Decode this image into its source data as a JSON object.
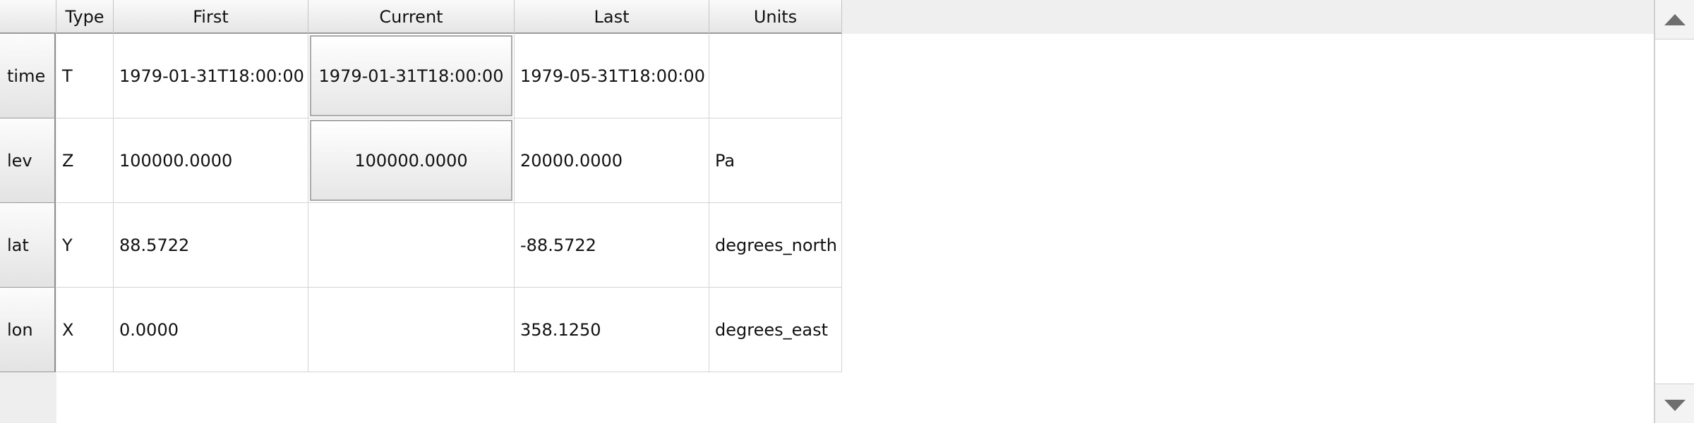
{
  "columns": {
    "type": "Type",
    "first": "First",
    "current": "Current",
    "last": "Last",
    "units": "Units"
  },
  "rows": [
    {
      "name": "time",
      "type": "T",
      "first": "1979-01-31T18:00:00",
      "current": "1979-01-31T18:00:00",
      "last": "1979-05-31T18:00:00",
      "units": ""
    },
    {
      "name": "lev",
      "type": "Z",
      "first": "100000.0000",
      "current": "100000.0000",
      "last": "20000.0000",
      "units": "Pa"
    },
    {
      "name": "lat",
      "type": "Y",
      "first": "88.5722",
      "current": "",
      "last": "-88.5722",
      "units": "degrees_north"
    },
    {
      "name": "lon",
      "type": "X",
      "first": "0.0000",
      "current": "",
      "last": "358.1250",
      "units": "degrees_east"
    }
  ],
  "scrollbar": {
    "up_icon": "triangle-up-icon",
    "down_icon": "triangle-down-icon"
  }
}
